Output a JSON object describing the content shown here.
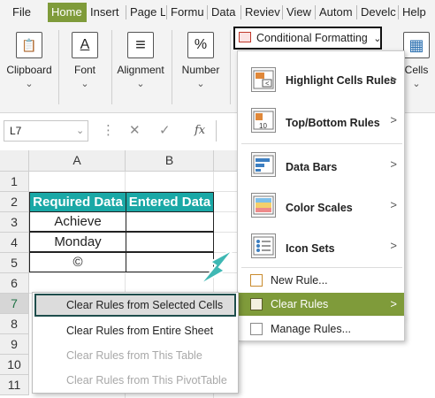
{
  "ribbon": {
    "tabs": [
      {
        "label": "File"
      },
      {
        "label": "Home"
      },
      {
        "label": "Insert"
      },
      {
        "label": "Page L"
      },
      {
        "label": "Formu"
      },
      {
        "label": "Data"
      },
      {
        "label": "Reviev"
      },
      {
        "label": "View"
      },
      {
        "label": "Autom"
      },
      {
        "label": "Develc"
      },
      {
        "label": "Help"
      }
    ],
    "groups": [
      {
        "label": "Clipboard",
        "icon": "clipboard-icon",
        "glyph": "📋"
      },
      {
        "label": "Font",
        "icon": "font-icon",
        "glyph": "A"
      },
      {
        "label": "Alignment",
        "icon": "alignment-icon",
        "glyph": "≡"
      },
      {
        "label": "Number",
        "icon": "percent-icon",
        "glyph": "%"
      },
      {
        "label": "Cells",
        "icon": "cells-icon",
        "glyph": "▦"
      }
    ],
    "chevron": "⌄",
    "conditional_formatting": "Conditional Formatting",
    "cf_chevron": "⌄"
  },
  "formula_bar": {
    "name_box": "L7",
    "name_box_chevron": "⌄",
    "more_icon": "⋮",
    "cancel": "✕",
    "enter": "✓",
    "fx": "fx"
  },
  "grid": {
    "columns": [
      "A",
      "B"
    ],
    "rows": [
      "1",
      "2",
      "3",
      "4",
      "5",
      "6",
      "7",
      "8",
      "9",
      "10",
      "11"
    ],
    "header_a": "Required Data",
    "header_b": "Entered Data",
    "a3": "Achieve",
    "a4": "Monday",
    "a5": "©"
  },
  "cf_menu": {
    "items": [
      {
        "label": "Highlight Cells Rules",
        "arrow": ">"
      },
      {
        "label": "Top/Bottom Rules",
        "arrow": ">"
      },
      {
        "label": "Data Bars",
        "arrow": ">"
      },
      {
        "label": "Color Scales",
        "arrow": ">"
      },
      {
        "label": "Icon Sets",
        "arrow": ">"
      }
    ],
    "top10_text": "10",
    "new_rule": "New Rule...",
    "clear_rules": "Clear Rules",
    "clear_arrow": ">",
    "manage_rules": "Manage Rules..."
  },
  "clear_submenu": {
    "items": [
      {
        "label": "Clear Rules from Selected Cells",
        "enabled": true
      },
      {
        "label": "Clear Rules from Entire Sheet",
        "enabled": true
      },
      {
        "label": "Clear Rules from This Table",
        "enabled": false
      },
      {
        "label": "Clear Rules from This PivotTable",
        "enabled": false
      }
    ]
  },
  "colors": {
    "accent_green": "#7f9b3a",
    "teal_header": "#1aa8a6",
    "arrow_teal": "#3fb8b4"
  }
}
